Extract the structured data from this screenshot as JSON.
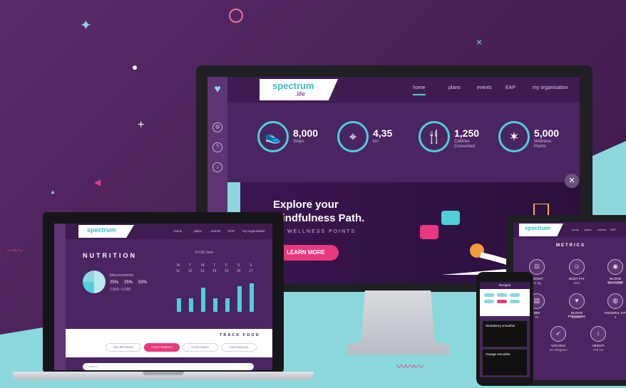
{
  "desktop": {
    "brand": {
      "name": "spectrum",
      "suffix": ".life"
    },
    "nav": [
      "home",
      "plans",
      "events",
      "EAP",
      "my organisation"
    ],
    "stats": [
      {
        "value": "8,000",
        "label": "Steps",
        "icon": "shoe-icon"
      },
      {
        "value": "4,35",
        "label": "km",
        "icon": "location-pin-icon"
      },
      {
        "value": "1,250",
        "label": "Calories Consumed",
        "icon": "fork-knife-icon"
      },
      {
        "value": "5,000",
        "label": "Wellness Points",
        "icon": "star-burst-icon"
      }
    ],
    "banner": {
      "headline": "Explore your Mindfulness Path.",
      "subtitle": "WELLNESS POINTS",
      "button": "LEARN MORE"
    }
  },
  "laptop": {
    "brand": {
      "name": "spectrum",
      "suffix": ".life"
    },
    "nav": [
      "home",
      "plans",
      "events",
      "EAP",
      "my organisation"
    ],
    "title": "NUTRITION",
    "macros": {
      "label": "Macronutrients",
      "carbs": "25%",
      "protein": "25%",
      "fat": "50%",
      "calories": "2,000 / 3,000"
    },
    "week_label": "Fri 08 June",
    "days": [
      "M",
      "T",
      "W",
      "T",
      "F",
      "S",
      "S"
    ],
    "dates": [
      "11",
      "12",
      "13",
      "14",
      "15",
      "16",
      "17"
    ],
    "bar_levels": [
      0.45,
      0.45,
      0.8,
      0.45,
      0.45,
      0.85,
      0.95
    ],
    "track": {
      "title": "TRACK FOOD",
      "buttons": [
        "RECIPE BOOK",
        "FOOD SEARCH",
        "FOOD DIARY",
        "CUSTOM LOG"
      ],
      "active_index": 1
    },
    "search_placeholder": "Search"
  },
  "tablet": {
    "brand": {
      "name": "spectrum",
      "suffix": ".life"
    },
    "nav": [
      "home",
      "plans",
      "events",
      "EAP",
      "my organisation"
    ],
    "title": "METRICS",
    "metrics": [
      {
        "label": "WEIGHT",
        "value": "72 kg",
        "icon": "scale-icon"
      },
      {
        "label": "BODY FAT",
        "value": "20%",
        "icon": "body-icon"
      },
      {
        "label": "BLOOD GLUCOSE",
        "value": "5.6 mmol/l",
        "icon": "glucose-icon"
      },
      {
        "label": "BMI",
        "value": "22",
        "icon": "bmi-icon"
      },
      {
        "label": "BLOOD PRESSURE",
        "value": "120/80",
        "icon": "heart-icon"
      },
      {
        "label": "VISCERAL FAT",
        "value": "6",
        "icon": "visceral-fat-icon"
      },
      {
        "label": "VO2 MAX",
        "value": "44 ml/kg/min",
        "icon": "runner-icon"
      },
      {
        "label": "HEIGHT",
        "value": "178 cm",
        "icon": "height-icon"
      }
    ]
  },
  "phone": {
    "header": "Recipes",
    "cards": [
      "Strawberry smoothie",
      "Orange smoothie"
    ]
  },
  "colors": {
    "background": "#4a2158",
    "teal": "#8ad8dc",
    "accent": "#e8397e",
    "panel": "#3e1c52"
  }
}
